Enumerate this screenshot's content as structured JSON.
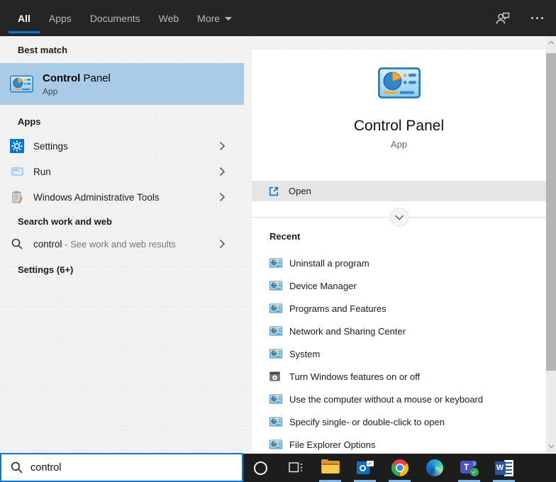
{
  "topbar": {
    "tabs": [
      {
        "label": "All",
        "active": true
      },
      {
        "label": "Apps",
        "active": false
      },
      {
        "label": "Documents",
        "active": false
      },
      {
        "label": "Web",
        "active": false
      },
      {
        "label": "More",
        "active": false
      }
    ]
  },
  "left": {
    "best_match_header": "Best match",
    "best_match": {
      "title_bold": "Control",
      "title_rest": " Panel",
      "subtitle": "App"
    },
    "apps_header": "Apps",
    "apps": [
      {
        "label": "Settings",
        "icon": "settings-gear"
      },
      {
        "label": "Run",
        "icon": "run-window"
      },
      {
        "label": "Windows Administrative Tools",
        "icon": "admin-tools"
      }
    ],
    "search_header": "Search work and web",
    "search_suggestion": {
      "query": "control",
      "rest": " - See work and web results"
    },
    "settings_header": "Settings (6+)"
  },
  "right": {
    "app_title": "Control Panel",
    "app_subtitle": "App",
    "open_label": "Open",
    "recent_header": "Recent",
    "recent": [
      {
        "label": "Uninstall a program",
        "icon": "control-panel"
      },
      {
        "label": "Device Manager",
        "icon": "control-panel"
      },
      {
        "label": "Programs and Features",
        "icon": "control-panel"
      },
      {
        "label": "Network and Sharing Center",
        "icon": "control-panel"
      },
      {
        "label": "System",
        "icon": "control-panel"
      },
      {
        "label": "Turn Windows features on or off",
        "icon": "windows-features"
      },
      {
        "label": "Use the computer without a mouse or keyboard",
        "icon": "control-panel"
      },
      {
        "label": "Specify single- or double-click to open",
        "icon": "control-panel"
      },
      {
        "label": "File Explorer Options",
        "icon": "control-panel"
      }
    ]
  },
  "search_box": {
    "value": "control"
  },
  "taskbar": {
    "items": [
      {
        "name": "cortana",
        "running": false
      },
      {
        "name": "task-view",
        "running": false
      },
      {
        "name": "file-explorer",
        "running": true
      },
      {
        "name": "outlook",
        "running": true
      },
      {
        "name": "chrome",
        "running": true
      },
      {
        "name": "edge",
        "running": false
      },
      {
        "name": "teams",
        "running": true
      },
      {
        "name": "word",
        "running": true
      }
    ]
  },
  "colors": {
    "accent": "#0078d7",
    "selection": "#a8cbe8",
    "topbar_bg": "#252525",
    "taskbar_bg": "#1d1d1d",
    "running_indicator": "#7ab7e8"
  }
}
